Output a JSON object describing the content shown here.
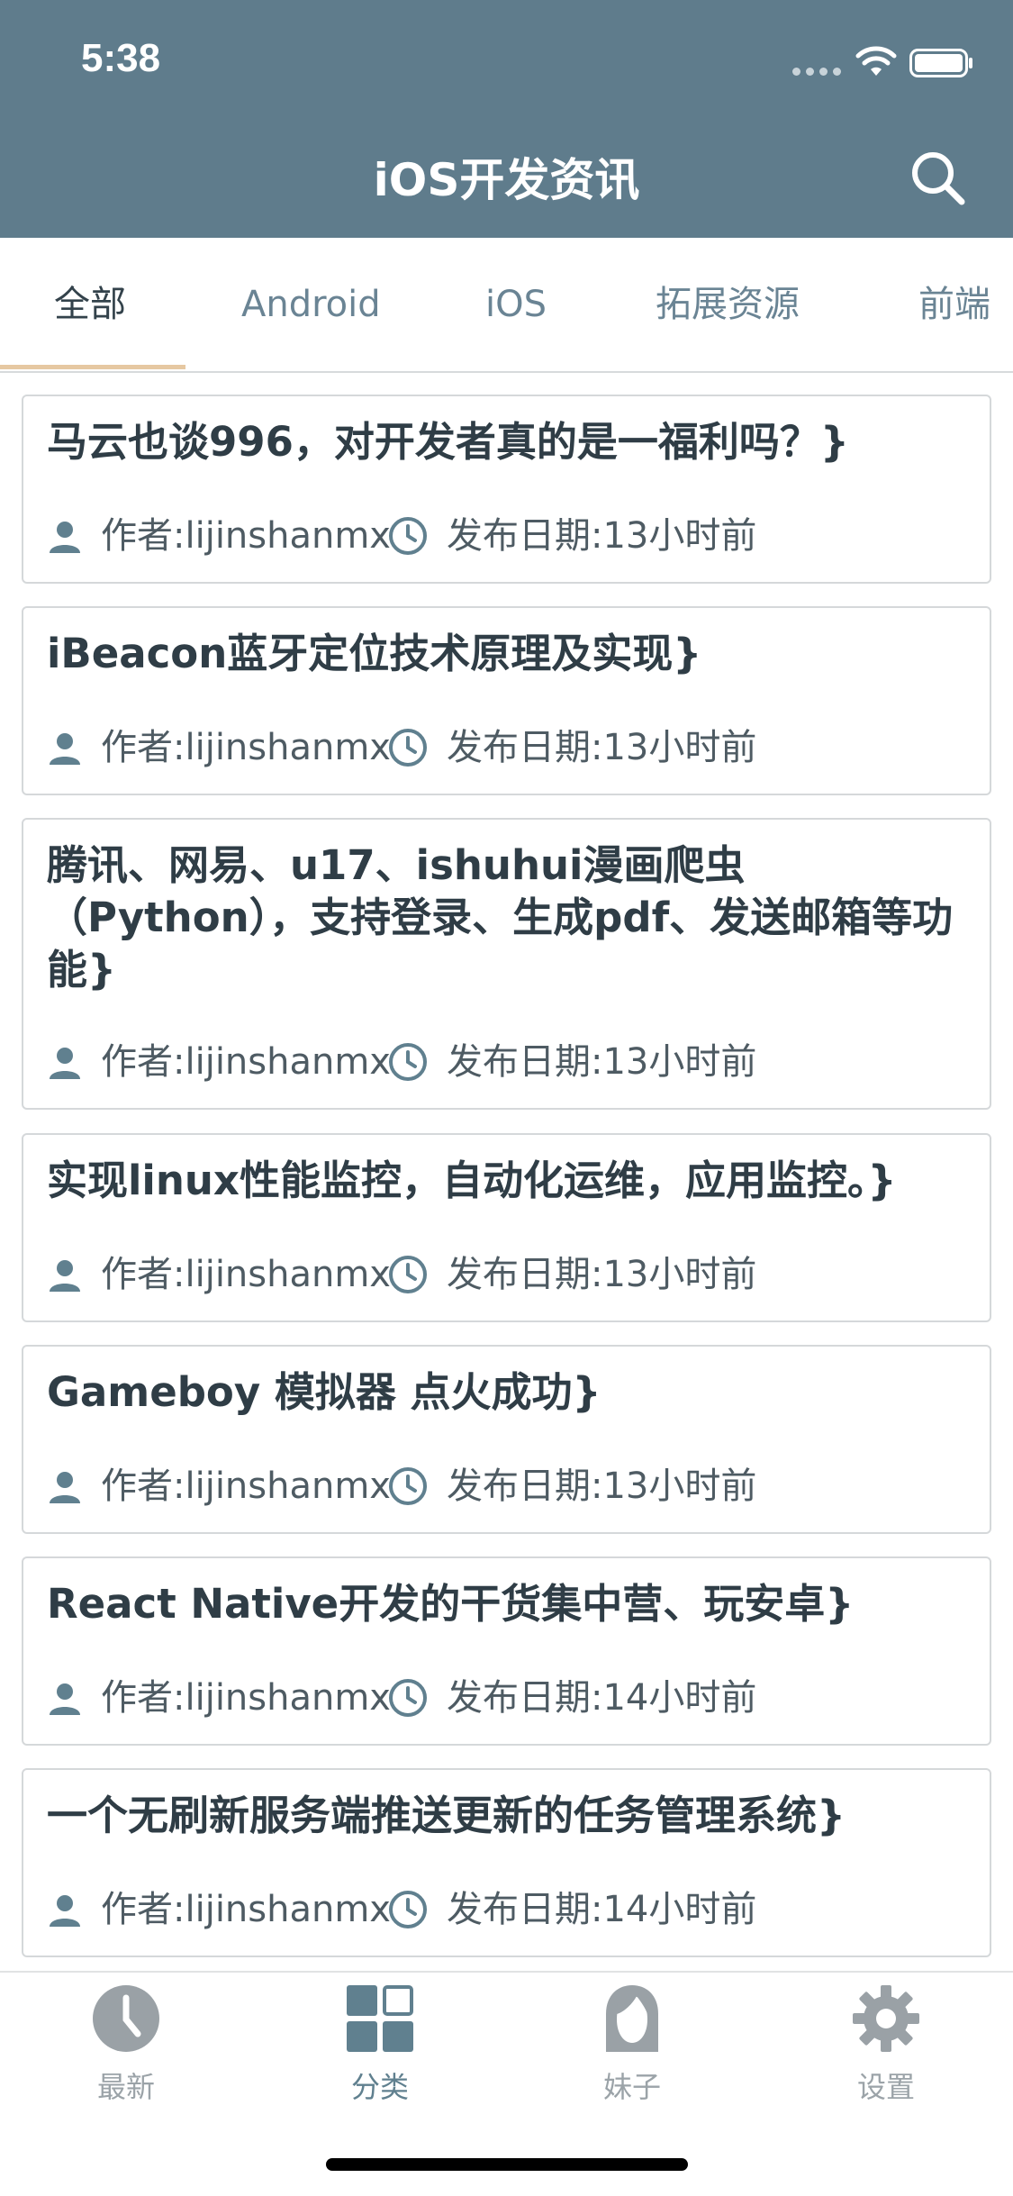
{
  "status": {
    "time": "5:38"
  },
  "header": {
    "title": "iOS开发资讯"
  },
  "tabs": [
    {
      "label": "全部"
    },
    {
      "label": "Android"
    },
    {
      "label": "iOS"
    },
    {
      "label": "拓展资源"
    },
    {
      "label": "前端"
    }
  ],
  "articles": [
    {
      "title": "马云也谈996，对开发者真的是一福利吗？}",
      "author": "作者:lijinshanmx",
      "date": "发布日期:13小时前"
    },
    {
      "title": "iBeacon蓝牙定位技术原理及实现}",
      "author": "作者:lijinshanmx",
      "date": "发布日期:13小时前"
    },
    {
      "title": "腾讯、网易、u17、ishuhui漫画爬虫（Python），支持登录、生成pdf、发送邮箱等功能}",
      "author": "作者:lijinshanmx",
      "date": "发布日期:13小时前"
    },
    {
      "title": "实现linux性能监控，自动化运维，应用监控。}",
      "author": "作者:lijinshanmx",
      "date": "发布日期:13小时前"
    },
    {
      "title": "Gameboy 模拟器 点火成功}",
      "author": "作者:lijinshanmx",
      "date": "发布日期:13小时前"
    },
    {
      "title": "React Native开发的干货集中营、玩安卓}",
      "author": "作者:lijinshanmx",
      "date": "发布日期:14小时前"
    },
    {
      "title": "一个无刷新服务端推送更新的任务管理系统}",
      "author": "作者:lijinshanmx",
      "date": "发布日期:14小时前"
    }
  ],
  "tabbar": [
    {
      "label": "最新",
      "icon": "clock-icon"
    },
    {
      "label": "分类",
      "icon": "grid-icon"
    },
    {
      "label": "妹子",
      "icon": "girl-icon"
    },
    {
      "label": "设置",
      "icon": "gear-icon"
    }
  ],
  "colors": {
    "header": "#5f7c8c",
    "accent": "#e6c8a2",
    "text": "#2f3d46"
  }
}
